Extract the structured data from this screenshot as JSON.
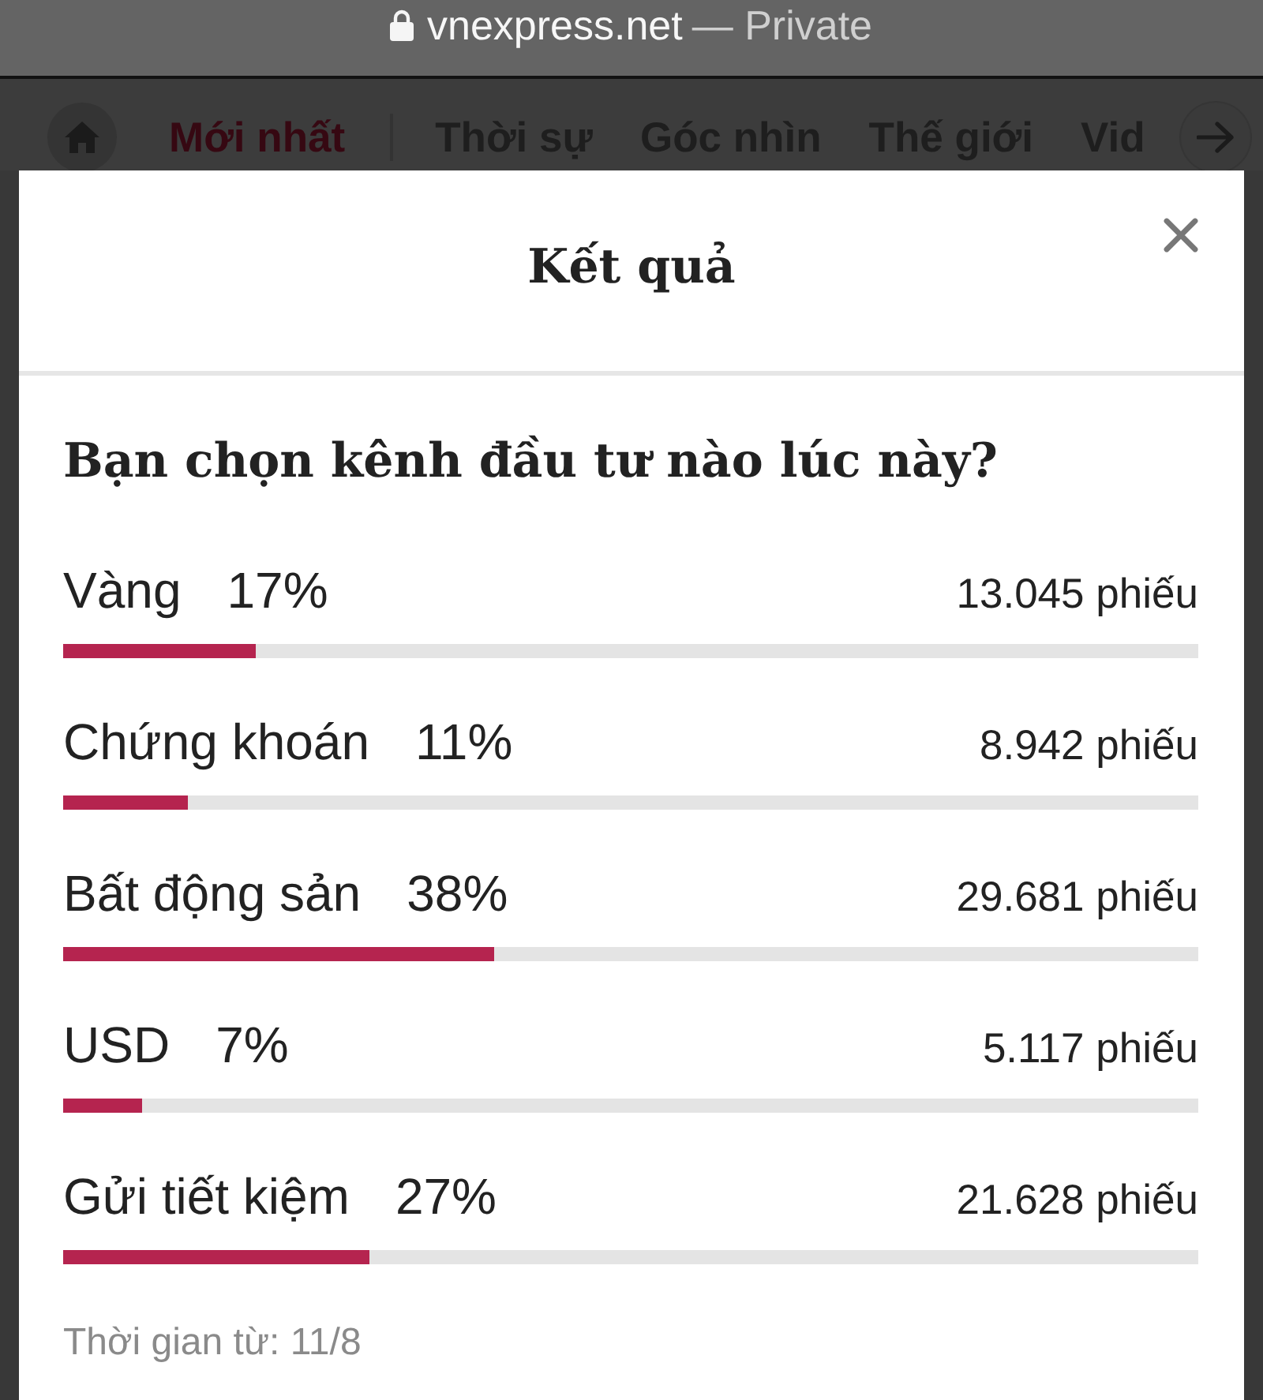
{
  "browser": {
    "domain": "vnexpress.net",
    "mode": "— Private"
  },
  "nav": {
    "tabs": [
      {
        "label": "Mới nhất",
        "selected": true
      },
      {
        "label": "Thời sự",
        "selected": false
      },
      {
        "label": "Góc nhìn",
        "selected": false
      },
      {
        "label": "Thế giới",
        "selected": false
      },
      {
        "label": "Vid",
        "selected": false
      }
    ]
  },
  "dialog": {
    "title": "Kết quả",
    "question": "Bạn chọn kênh đầu tư nào lúc này?",
    "options": [
      {
        "label": "Vàng",
        "percent": "17%",
        "votes": "13.045 phiếu",
        "level": 0.17
      },
      {
        "label": "Chứng khoán",
        "percent": "11%",
        "votes": "8.942 phiếu",
        "level": 0.11
      },
      {
        "label": "Bất động sản",
        "percent": "38%",
        "votes": "29.681 phiếu",
        "level": 0.38
      },
      {
        "label": "USD",
        "percent": "7%",
        "votes": "5.117 phiếu",
        "level": 0.07
      },
      {
        "label": "Gửi tiết kiệm",
        "percent": "27%",
        "votes": "21.628 phiếu",
        "level": 0.27
      }
    ],
    "footer": "Thời gian từ: 11/8"
  }
}
